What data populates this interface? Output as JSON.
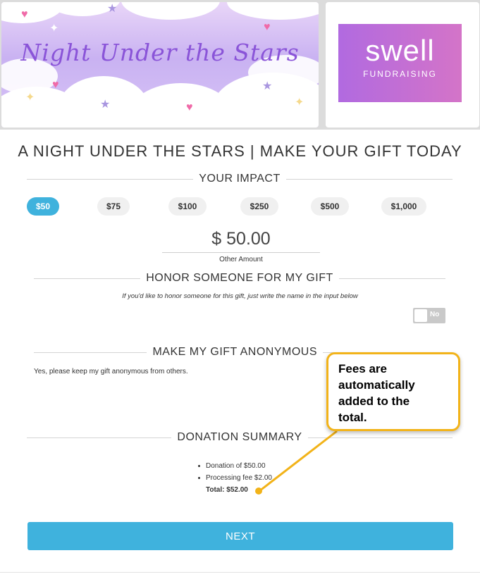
{
  "banner": {
    "event_title": "Night Under the Stars",
    "logo_word": "swell",
    "logo_subtitle": "FUNDRAISING"
  },
  "page_title": "A NIGHT UNDER THE STARS | MAKE YOUR GIFT TODAY",
  "impact": {
    "heading": "YOUR IMPACT",
    "amounts": [
      "$50",
      "$75",
      "$100",
      "$250",
      "$500",
      "$1,000"
    ],
    "selected": "$50",
    "amount_value": "$ 50.00",
    "other_amount_label": "Other Amount"
  },
  "honor": {
    "heading": "HONOR SOMEONE FOR MY GIFT",
    "helper": "If you'd like to honor someone for this gift, just write the name in the input below",
    "toggle_label": "No"
  },
  "anonymous": {
    "heading": "MAKE MY GIFT ANONYMOUS",
    "text": "Yes, please keep my gift anonymous from others."
  },
  "summary": {
    "heading": "DONATION SUMMARY",
    "items": [
      "Donation of $50.00",
      "Processing fee $2.00"
    ],
    "total": "Total: $52.00"
  },
  "next_button": "NEXT",
  "callout": {
    "lines": [
      "Fees are",
      "automatically",
      "added to the",
      "total."
    ],
    "color": "#f2b319"
  },
  "colors": {
    "accent": "#3fb2dd",
    "callout_border": "#f2b319"
  }
}
